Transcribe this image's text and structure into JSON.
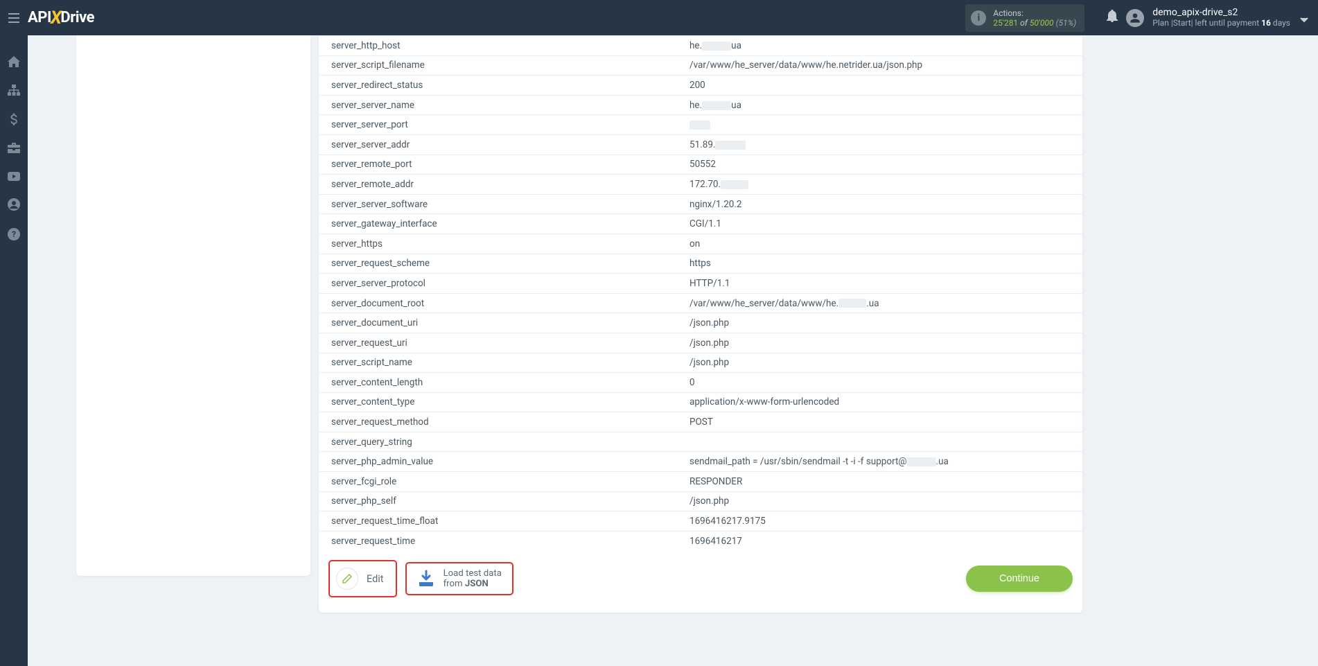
{
  "logo": {
    "part1": "API",
    "x": "X",
    "part2": "Drive"
  },
  "actions": {
    "label": "Actions:",
    "count": "25'281",
    "of": "of",
    "limit": "50'000",
    "pct": "(51%)"
  },
  "user": {
    "name": "demo_apix-drive_s2",
    "plan_prefix": "Plan |Start| left until payment",
    "days_num": "16",
    "days_word": "days"
  },
  "rows": [
    {
      "k": "server_http_host",
      "v_pre": "he.",
      "blur_w": 42,
      "v_post": "ua"
    },
    {
      "k": "server_script_filename",
      "v": "/var/www/he_server/data/www/he.netrider.ua/json.php"
    },
    {
      "k": "server_redirect_status",
      "v": "200"
    },
    {
      "k": "server_server_name",
      "v_pre": "he.",
      "blur_w": 42,
      "v_post": "ua"
    },
    {
      "k": "server_server_port",
      "blur_only": 30
    },
    {
      "k": "server_server_addr",
      "v_pre": "51.89.",
      "blur_w": 44
    },
    {
      "k": "server_remote_port",
      "v": "50552"
    },
    {
      "k": "server_remote_addr",
      "v_pre": "172.70.",
      "blur_w": 40
    },
    {
      "k": "server_server_software",
      "v": "nginx/1.20.2"
    },
    {
      "k": "server_gateway_interface",
      "v": "CGI/1.1"
    },
    {
      "k": "server_https",
      "v": "on"
    },
    {
      "k": "server_request_scheme",
      "v": "https"
    },
    {
      "k": "server_server_protocol",
      "v": "HTTP/1.1"
    },
    {
      "k": "server_document_root",
      "v_pre": "/var/www/he_server/data/www/he.",
      "blur_w": 40,
      "v_post": ".ua"
    },
    {
      "k": "server_document_uri",
      "v": "/json.php"
    },
    {
      "k": "server_request_uri",
      "v": "/json.php"
    },
    {
      "k": "server_script_name",
      "v": "/json.php"
    },
    {
      "k": "server_content_length",
      "v": "0"
    },
    {
      "k": "server_content_type",
      "v": "application/x-www-form-urlencoded"
    },
    {
      "k": "server_request_method",
      "v": "POST"
    },
    {
      "k": "server_query_string",
      "v": ""
    },
    {
      "k": "server_php_admin_value",
      "v_pre": "sendmail_path = /usr/sbin/sendmail -t -i -f support@",
      "blur_w": 42,
      "v_post": ".ua"
    },
    {
      "k": "server_fcgi_role",
      "v": "RESPONDER"
    },
    {
      "k": "server_php_self",
      "v": "/json.php"
    },
    {
      "k": "server_request_time_float",
      "v": "1696416217.9175"
    },
    {
      "k": "server_request_time",
      "v": "1696416217"
    }
  ],
  "buttons": {
    "edit": "Edit",
    "load_l1": "Load test data",
    "load_l2a": "from ",
    "load_l2b": "JSON",
    "continue": "Continue"
  }
}
